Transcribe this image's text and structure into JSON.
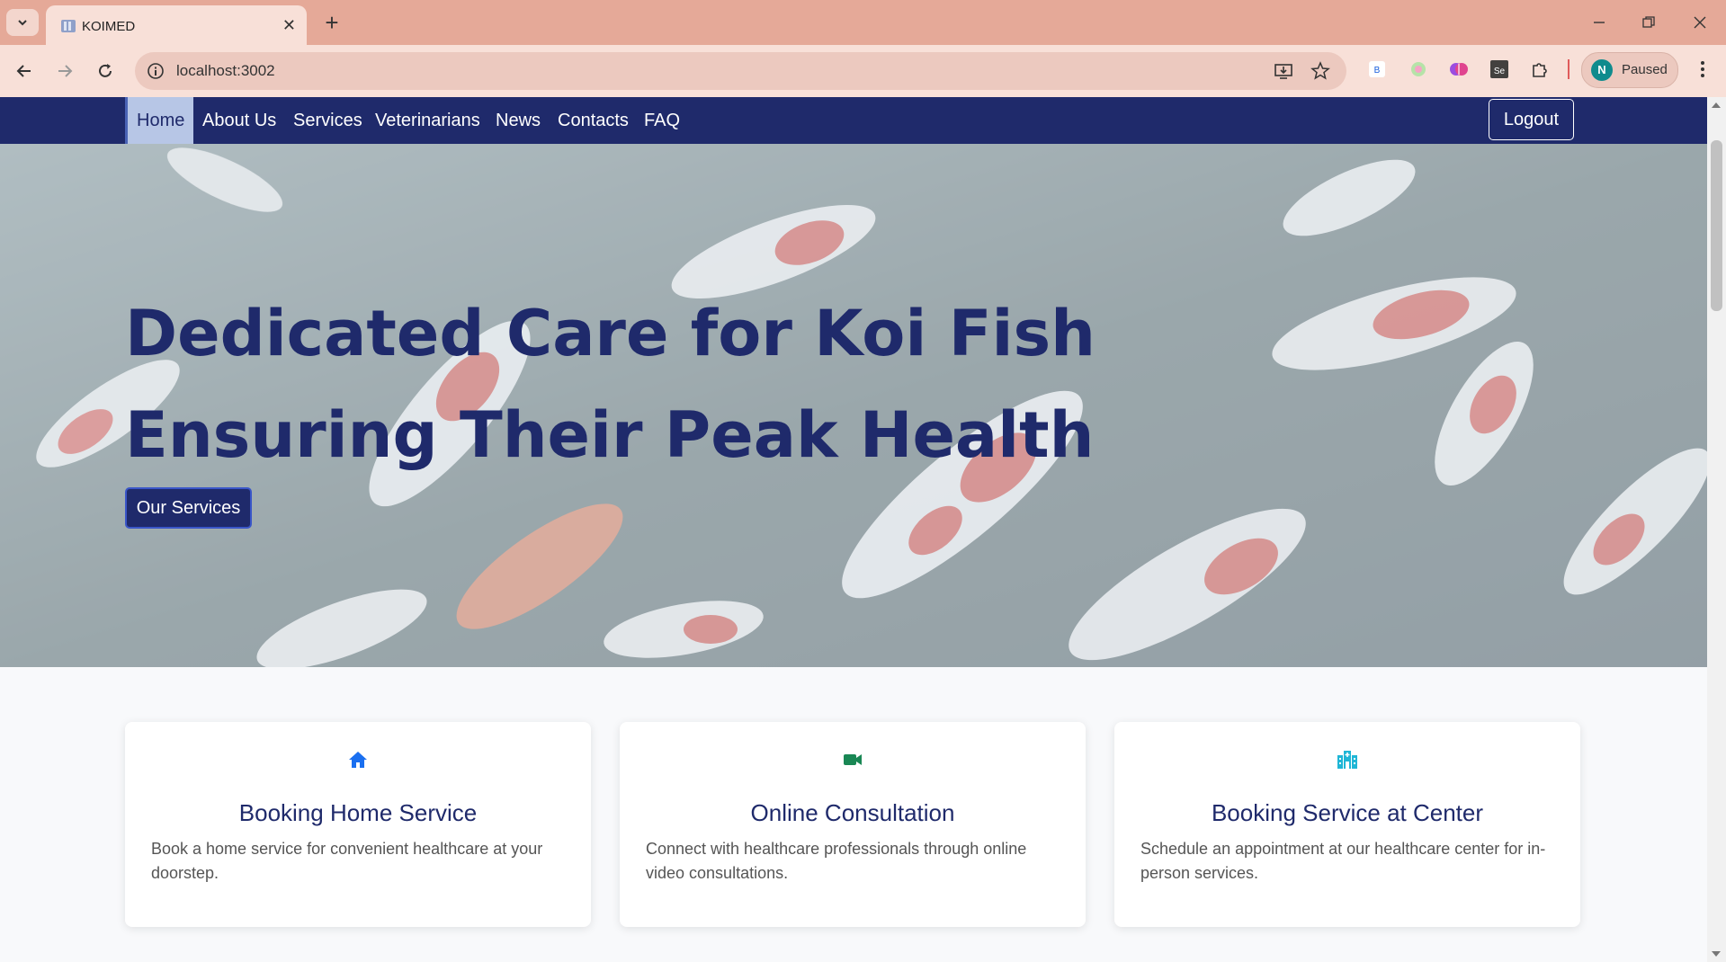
{
  "browser": {
    "tab_title": "KOIMED",
    "url": "localhost:3002",
    "profile_initial": "N",
    "profile_status": "Paused",
    "extensions": [
      "bitwarden-icon",
      "color-picker-icon",
      "brain-icon",
      "selenium-icon",
      "puzzle-icon"
    ]
  },
  "nav": {
    "items": [
      {
        "label": "Home",
        "active": true
      },
      {
        "label": "About Us"
      },
      {
        "label": "Services"
      },
      {
        "label": "Veterinarians"
      },
      {
        "label": "News"
      },
      {
        "label": "Contacts"
      },
      {
        "label": "FAQ"
      }
    ],
    "logout_label": "Logout"
  },
  "hero": {
    "title_line1": "Dedicated Care for Koi Fish",
    "title_line2": "Ensuring Their Peak Health",
    "button_label": "Our Services"
  },
  "services": [
    {
      "icon": "home-icon",
      "icon_color": "#1a6ff0",
      "title": "Booking Home Service",
      "description": "Book a home service for convenient healthcare at your doorstep."
    },
    {
      "icon": "video-camera-icon",
      "icon_color": "#198754",
      "title": "Online Consultation",
      "description": "Connect with healthcare professionals through online video consultations."
    },
    {
      "icon": "hospital-building-icon",
      "icon_color": "#1fb6d6",
      "title": "Booking Service at Center",
      "description": "Schedule an appointment at our healthcare center for in-person services."
    }
  ],
  "colors": {
    "nav_background": "#1f2a6b",
    "title_color": "#1f2a6b",
    "active_nav_background": "#b7c6e6"
  }
}
